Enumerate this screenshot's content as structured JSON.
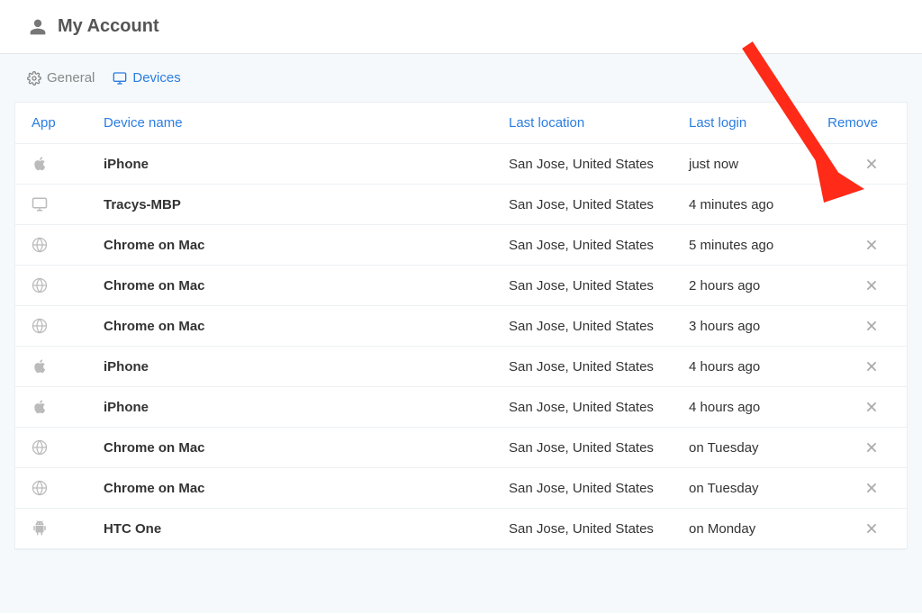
{
  "header": {
    "title": "My Account"
  },
  "tabs": {
    "general": "General",
    "devices": "Devices"
  },
  "table": {
    "headers": {
      "app": "App",
      "device": "Device name",
      "location": "Last location",
      "login": "Last login",
      "remove": "Remove"
    },
    "rows": [
      {
        "icon": "apple",
        "device": "iPhone",
        "location": "San Jose, United States",
        "login": "just now",
        "removable": true
      },
      {
        "icon": "monitor",
        "device": "Tracys-MBP",
        "location": "San Jose, United States",
        "login": "4 minutes ago",
        "removable": false
      },
      {
        "icon": "globe",
        "device": "Chrome on Mac",
        "location": "San Jose, United States",
        "login": "5 minutes ago",
        "removable": true
      },
      {
        "icon": "globe",
        "device": "Chrome on Mac",
        "location": "San Jose, United States",
        "login": "2 hours ago",
        "removable": true
      },
      {
        "icon": "globe",
        "device": "Chrome on Mac",
        "location": "San Jose, United States",
        "login": "3 hours ago",
        "removable": true
      },
      {
        "icon": "apple",
        "device": "iPhone",
        "location": "San Jose, United States",
        "login": "4 hours ago",
        "removable": true
      },
      {
        "icon": "apple",
        "device": "iPhone",
        "location": "San Jose, United States",
        "login": "4 hours ago",
        "removable": true
      },
      {
        "icon": "globe",
        "device": "Chrome on Mac",
        "location": "San Jose, United States",
        "login": "on Tuesday",
        "removable": true
      },
      {
        "icon": "globe",
        "device": "Chrome on Mac",
        "location": "San Jose, United States",
        "login": "on Tuesday",
        "removable": true
      },
      {
        "icon": "android",
        "device": "HTC One",
        "location": "San Jose, United States",
        "login": "on Monday",
        "removable": true
      }
    ]
  }
}
